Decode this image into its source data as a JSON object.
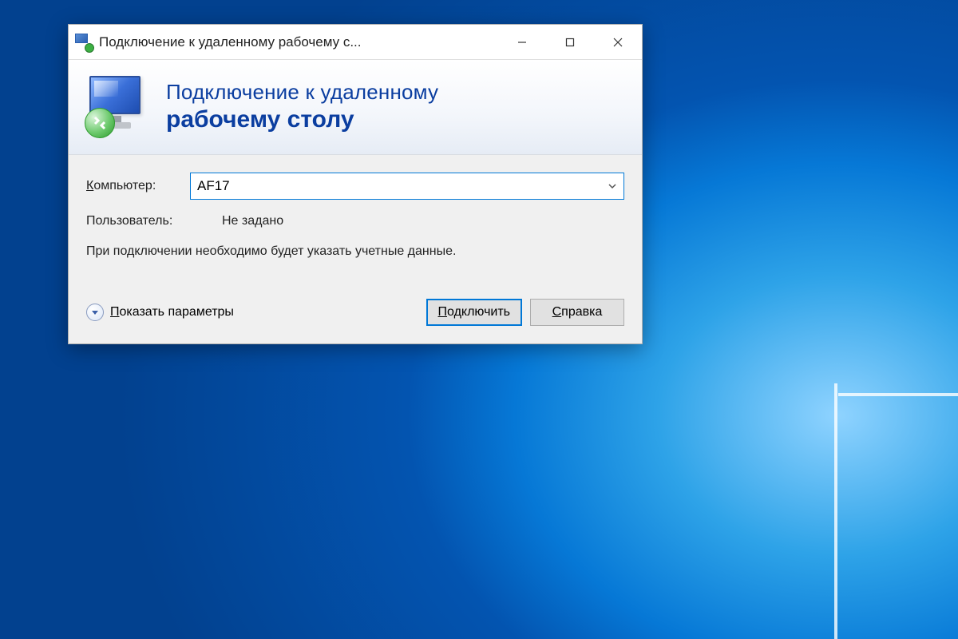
{
  "window": {
    "title": "Подключение к удаленному рабочему с..."
  },
  "banner": {
    "line1": "Подключение к удаленному",
    "line2": "рабочему столу"
  },
  "form": {
    "computer_label_pre": "К",
    "computer_label_rest": "омпьютер:",
    "computer_value": "AF17",
    "user_label": "Пользователь:",
    "user_value": "Не задано",
    "hint": "При подключении необходимо будет указать учетные данные."
  },
  "footer": {
    "expand_pre": "П",
    "expand_rest": "оказать параметры",
    "connect_pre": "П",
    "connect_rest": "одключить",
    "help_pre": "С",
    "help_rest": "правка"
  }
}
